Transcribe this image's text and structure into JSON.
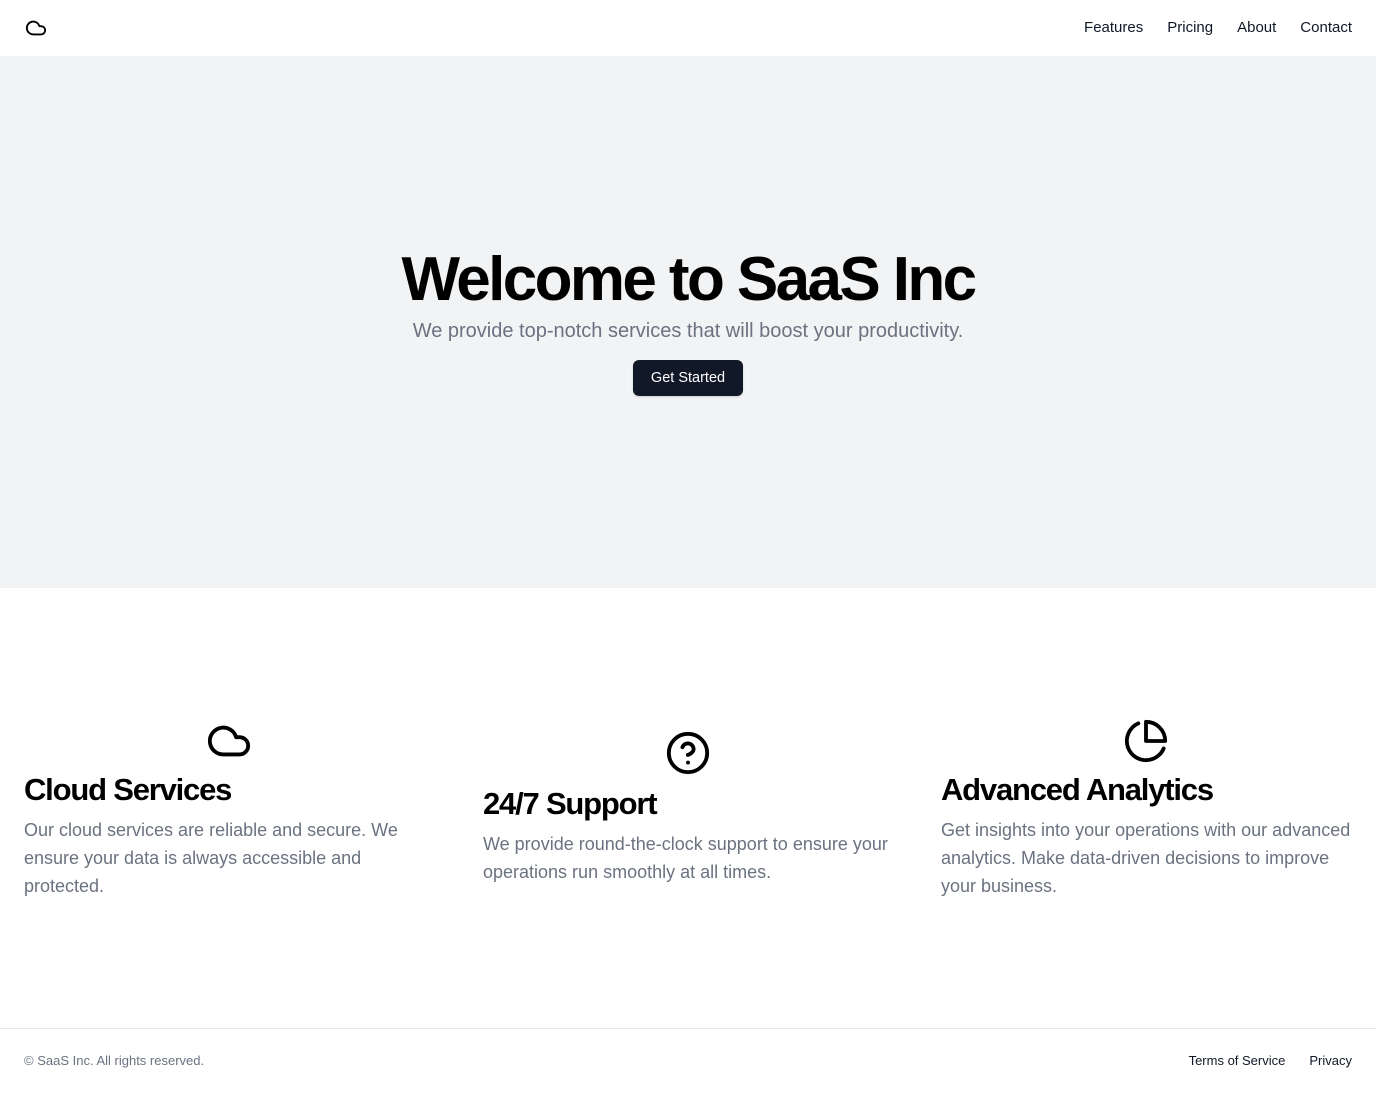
{
  "header": {
    "logo_icon": "cloud-icon",
    "nav": [
      {
        "label": "Features"
      },
      {
        "label": "Pricing"
      },
      {
        "label": "About"
      },
      {
        "label": "Contact"
      }
    ]
  },
  "hero": {
    "title": "Welcome to SaaS Inc",
    "subtitle": "We provide top-notch services that will boost your productivity.",
    "cta_label": "Get Started"
  },
  "features": [
    {
      "icon": "cloud-icon",
      "title": "Cloud Services",
      "description": "Our cloud services are reliable and secure. We ensure your data is always accessible and protected."
    },
    {
      "icon": "help-circle-icon",
      "title": "24/7 Support",
      "description": "We provide round-the-clock support to ensure your operations run smoothly at all times."
    },
    {
      "icon": "pie-chart-icon",
      "title": "Advanced Analytics",
      "description": "Get insights into your operations with our advanced analytics. Make data-driven decisions to improve your business."
    }
  ],
  "footer": {
    "copyright": "© SaaS Inc. All rights reserved.",
    "links": [
      {
        "label": "Terms of Service"
      },
      {
        "label": "Privacy"
      }
    ]
  },
  "colors": {
    "hero_background": "#f2f3f5",
    "button_background": "#111827",
    "muted_text": "#6b7280"
  }
}
